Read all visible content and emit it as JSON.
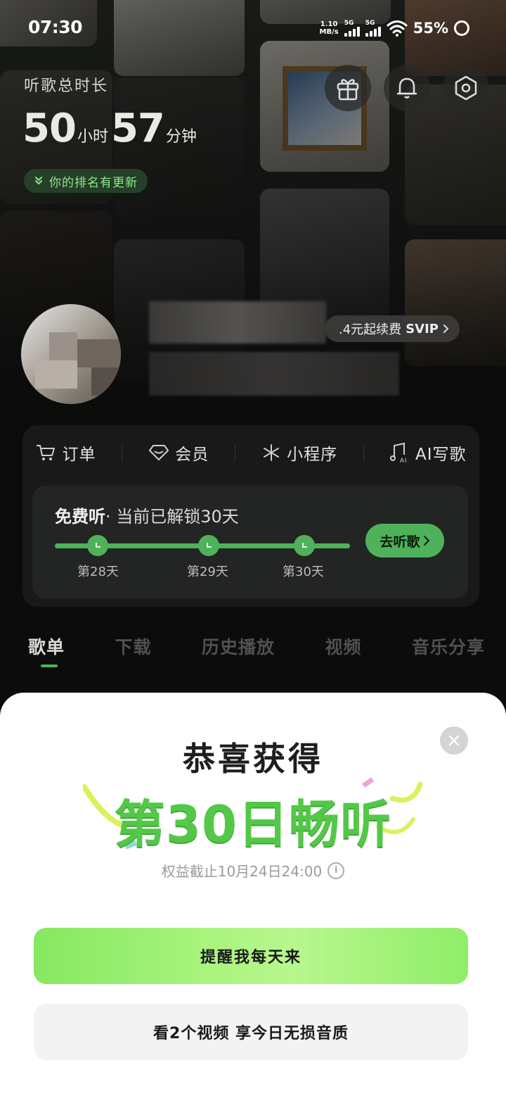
{
  "status_bar": {
    "time": "07:30",
    "net_speed_value": "1.10",
    "net_speed_unit": "MB/s",
    "signal_1_label": "5G",
    "signal_2_label": "5G",
    "battery": "55%"
  },
  "header": {
    "total_label": "听歌总时长",
    "hours": "50",
    "hours_unit": "小时",
    "minutes": "57",
    "minutes_unit": "分钟",
    "rank_update": "你的排名有更新",
    "icons": [
      "gift-icon",
      "bell-icon",
      "settings-icon"
    ]
  },
  "profile": {
    "svip_prefix": ".4元起续费",
    "svip_tag": "SVIP"
  },
  "quick_actions": [
    {
      "label": "订单",
      "icon": "cart-icon"
    },
    {
      "label": "会员",
      "icon": "diamond-icon"
    },
    {
      "label": "小程序",
      "icon": "asterisk-icon"
    },
    {
      "label": "AI写歌",
      "icon": "ai-music-icon"
    }
  ],
  "free_listen": {
    "title": "免费听",
    "subtitle": "· 当前已解锁30天",
    "days": [
      "第28天",
      "第29天",
      "第30天"
    ],
    "button": "去听歌"
  },
  "tabs": [
    "歌单",
    "下载",
    "历史播放",
    "视频",
    "音乐分享"
  ],
  "active_tab": "歌单",
  "popup": {
    "congrats": "恭喜获得",
    "reward": "第30日畅听",
    "validity": "权益截止10月24日24:00",
    "primary_button": "提醒我每天来",
    "secondary_button": "看2个视频 享今日无损音质"
  },
  "colors": {
    "accent_green": "#4fb25a",
    "reward_green": "#53c848",
    "button_green": "#a9f47e"
  }
}
